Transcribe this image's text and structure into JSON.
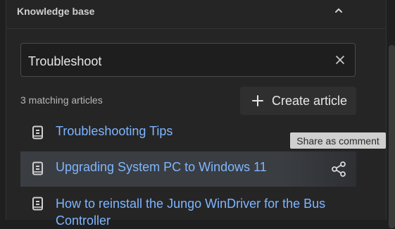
{
  "header": {
    "title": "Knowledge base",
    "collapse_icon": "chevron-up-icon"
  },
  "search": {
    "value": "Troubleshoot",
    "clear_icon": "close-icon"
  },
  "results": {
    "count_label": "3 matching articles"
  },
  "create": {
    "label": "Create article",
    "icon": "plus-icon"
  },
  "articles": [
    {
      "title": "Troubleshooting Tips",
      "icon": "article-icon"
    },
    {
      "title": "Upgrading System PC to Windows 11",
      "icon": "article-icon",
      "action_icon": "share-icon"
    },
    {
      "title": "How to reinstall the Jungo WinDriver for the Bus Controller",
      "icon": "article-icon"
    }
  ],
  "tooltip": {
    "text": "Share as comment"
  },
  "colors": {
    "background": "#252526",
    "link": "#7eb6ff",
    "highlight_row": "#3a3d41",
    "tooltip_bg": "#cfcfcf"
  }
}
